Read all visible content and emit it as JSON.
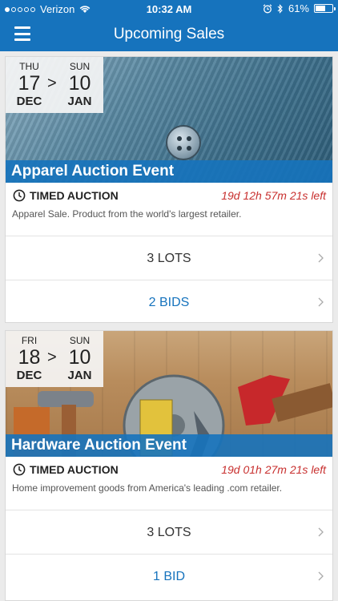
{
  "status_bar": {
    "carrier": "Verizon",
    "time": "10:32 AM",
    "battery": "61%",
    "battery_level": 0.61
  },
  "nav": {
    "title": "Upcoming Sales"
  },
  "sales": [
    {
      "start": {
        "dow": "THU",
        "day": "17",
        "month": "DEC"
      },
      "end": {
        "dow": "SUN",
        "day": "10",
        "month": "JAN"
      },
      "separator": ">",
      "title": "Apparel Auction Event",
      "auction_type": "TIMED AUCTION",
      "time_left": "19d 12h 57m 21s left",
      "description": "Apparel Sale. Product from the world's largest retailer.",
      "lots": "3 LOTS",
      "bids": "2 BIDS"
    },
    {
      "start": {
        "dow": "FRI",
        "day": "18",
        "month": "DEC"
      },
      "end": {
        "dow": "SUN",
        "day": "10",
        "month": "JAN"
      },
      "separator": ">",
      "title": "Hardware Auction Event",
      "auction_type": "TIMED AUCTION",
      "time_left": "19d 01h 27m 21s left",
      "description": "Home improvement goods from America's leading .com retailer.",
      "lots": "3 LOTS",
      "bids": "1 BID"
    }
  ],
  "colors": {
    "primary": "#1673bd",
    "time_left": "#c8302f",
    "background": "#ebebeb"
  },
  "icons": {
    "menu": "hamburger-menu-icon",
    "clock": "clock-icon",
    "chevron": "chevron-right-icon"
  }
}
